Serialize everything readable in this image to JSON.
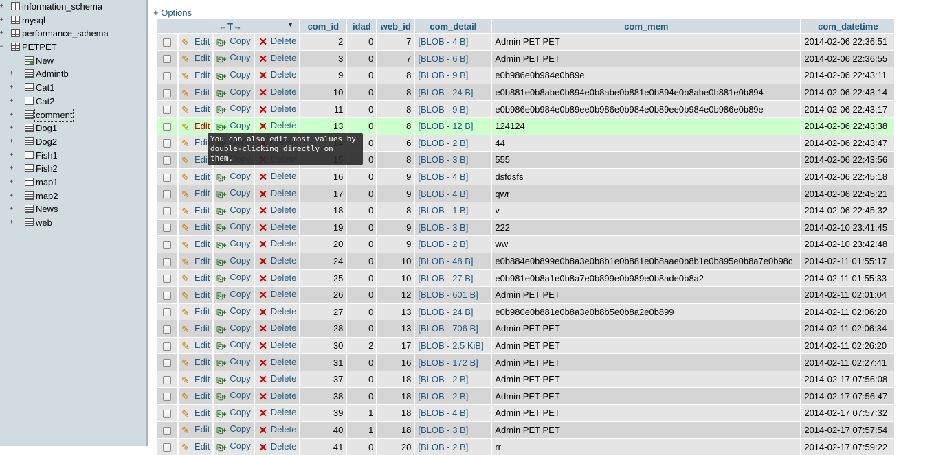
{
  "nav": {
    "databases": [
      "information_schema",
      "mysql",
      "performance_schema",
      "PETPET"
    ],
    "tables": [
      "New",
      "Admintb",
      "Cat1",
      "Cat2",
      "comment",
      "Dog1",
      "Dog2",
      "Fish1",
      "Fish2",
      "map1",
      "map2",
      "News",
      "web"
    ],
    "selected_table": "comment"
  },
  "options_link": "+ Options",
  "columns": {
    "tools": "←T→",
    "com_id": "com_id",
    "idad": "idad",
    "web_id": "web_id",
    "com_detail": "com_detail",
    "com_mem": "com_mem",
    "com_datetime": "com_datetime"
  },
  "actions": {
    "edit": "Edit",
    "copy": "Copy",
    "delete": "Delete"
  },
  "tooltip": "You can also edit most values by double-clicking directly on them.",
  "rows": [
    {
      "com_id": "2",
      "idad": "0",
      "web_id": "7",
      "com_detail": "[BLOB - 4 B]",
      "com_mem": "Admin PET PET",
      "com_datetime": "2014-02-06 22:36:51"
    },
    {
      "com_id": "3",
      "idad": "0",
      "web_id": "7",
      "com_detail": "[BLOB - 6 B]",
      "com_mem": "Admin PET PET",
      "com_datetime": "2014-02-06 22:36:55"
    },
    {
      "com_id": "9",
      "idad": "0",
      "web_id": "8",
      "com_detail": "[BLOB - 9 B]",
      "com_mem": "e0b986e0b984e0b89e",
      "com_datetime": "2014-02-06 22:43:11"
    },
    {
      "com_id": "10",
      "idad": "0",
      "web_id": "8",
      "com_detail": "[BLOB - 24 B]",
      "com_mem": "e0b881e0b8abe0b894e0b8abe0b881e0b894e0b8abe0b881e0b894",
      "com_datetime": "2014-02-06 22:43:14"
    },
    {
      "com_id": "11",
      "idad": "0",
      "web_id": "8",
      "com_detail": "[BLOB - 9 B]",
      "com_mem": "e0b986e0b984e0b89ee0b986e0b984e0b89ee0b984e0b986e0b89e",
      "com_datetime": "2014-02-06 22:43:17"
    },
    {
      "com_id": "13",
      "idad": "0",
      "web_id": "8",
      "com_detail": "[BLOB - 12 B]",
      "com_mem": "124124",
      "com_datetime": "2014-02-06 22:43:38"
    },
    {
      "com_id": "14",
      "idad": "0",
      "web_id": "6",
      "com_detail": "[BLOB - 2 B]",
      "com_mem": "44",
      "com_datetime": "2014-02-06 22:43:47"
    },
    {
      "com_id": "15",
      "idad": "0",
      "web_id": "8",
      "com_detail": "[BLOB - 3 B]",
      "com_mem": "555",
      "com_datetime": "2014-02-06 22:43:56"
    },
    {
      "com_id": "16",
      "idad": "0",
      "web_id": "9",
      "com_detail": "[BLOB - 4 B]",
      "com_mem": "dsfdsfs",
      "com_datetime": "2014-02-06 22:45:18"
    },
    {
      "com_id": "17",
      "idad": "0",
      "web_id": "9",
      "com_detail": "[BLOB - 4 B]",
      "com_mem": "qwr",
      "com_datetime": "2014-02-06 22:45:21"
    },
    {
      "com_id": "18",
      "idad": "0",
      "web_id": "8",
      "com_detail": "[BLOB - 1 B]",
      "com_mem": "v",
      "com_datetime": "2014-02-06 22:45:32"
    },
    {
      "com_id": "19",
      "idad": "0",
      "web_id": "9",
      "com_detail": "[BLOB - 3 B]",
      "com_mem": "222",
      "com_datetime": "2014-02-10 23:41:45"
    },
    {
      "com_id": "20",
      "idad": "0",
      "web_id": "9",
      "com_detail": "[BLOB - 2 B]",
      "com_mem": "ww",
      "com_datetime": "2014-02-10 23:42:48"
    },
    {
      "com_id": "24",
      "idad": "0",
      "web_id": "10",
      "com_detail": "[BLOB - 48 B]",
      "com_mem": "e0b884e0b899e0b8a3e0b8b1e0b881e0b8aae0b8b1e0b895e0b8a7e0b98c",
      "com_datetime": "2014-02-11 01:55:17"
    },
    {
      "com_id": "25",
      "idad": "0",
      "web_id": "10",
      "com_detail": "[BLOB - 27 B]",
      "com_mem": "e0b981e0b8a1e0b8a7e0b899e0b989e0b8ade0b8a2",
      "com_datetime": "2014-02-11 01:55:33"
    },
    {
      "com_id": "26",
      "idad": "0",
      "web_id": "12",
      "com_detail": "[BLOB - 601 B]",
      "com_mem": "Admin PET PET",
      "com_datetime": "2014-02-11 02:01:04"
    },
    {
      "com_id": "27",
      "idad": "0",
      "web_id": "13",
      "com_detail": "[BLOB - 24 B]",
      "com_mem": "e0b980e0b881e0b8a3e0b8b5e0b8a2e0b899",
      "com_datetime": "2014-02-11 02:06:20"
    },
    {
      "com_id": "28",
      "idad": "0",
      "web_id": "13",
      "com_detail": "[BLOB - 706 B]",
      "com_mem": "Admin PET PET",
      "com_datetime": "2014-02-11 02:06:34"
    },
    {
      "com_id": "30",
      "idad": "2",
      "web_id": "17",
      "com_detail": "[BLOB - 2.5 KiB]",
      "com_mem": "Admin PET PET",
      "com_datetime": "2014-02-11 02:26:20"
    },
    {
      "com_id": "31",
      "idad": "0",
      "web_id": "16",
      "com_detail": "[BLOB - 172 B]",
      "com_mem": "Admin PET PET",
      "com_datetime": "2014-02-11 02:27:41"
    },
    {
      "com_id": "37",
      "idad": "0",
      "web_id": "18",
      "com_detail": "[BLOB - 2 B]",
      "com_mem": "Admin PET PET",
      "com_datetime": "2014-02-17 07:56:08"
    },
    {
      "com_id": "38",
      "idad": "0",
      "web_id": "18",
      "com_detail": "[BLOB - 2 B]",
      "com_mem": "Admin PET PET",
      "com_datetime": "2014-02-17 07:56:47"
    },
    {
      "com_id": "39",
      "idad": "1",
      "web_id": "18",
      "com_detail": "[BLOB - 4 B]",
      "com_mem": "Admin PET PET",
      "com_datetime": "2014-02-17 07:57:32"
    },
    {
      "com_id": "40",
      "idad": "1",
      "web_id": "18",
      "com_detail": "[BLOB - 3 B]",
      "com_mem": "Admin PET PET",
      "com_datetime": "2014-02-17 07:57:54"
    },
    {
      "com_id": "41",
      "idad": "0",
      "web_id": "20",
      "com_detail": "[BLOB - 2 B]",
      "com_mem": "rr",
      "com_datetime": "2014-02-17 07:59:22"
    }
  ],
  "highlighted_row_index": 5,
  "colors": {
    "header_bg": "#d3dce3",
    "link": "#235a81",
    "marked_row": "#ccffcc",
    "nav_bg": "#d0dce0"
  }
}
